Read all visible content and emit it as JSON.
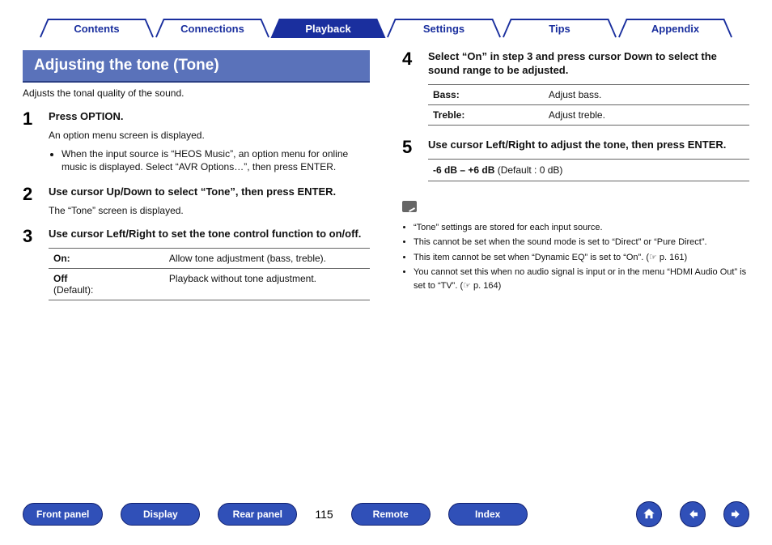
{
  "tabs": {
    "contents": "Contents",
    "connections": "Connections",
    "playback": "Playback",
    "settings": "Settings",
    "tips": "Tips",
    "appendix": "Appendix",
    "active_index": 2
  },
  "heading": "Adjusting the tone (Tone)",
  "subtitle": "Adjusts the tonal quality of the sound.",
  "steps": {
    "s1": {
      "num": "1",
      "title": "Press OPTION.",
      "desc": "An option menu screen is displayed.",
      "bullet": "When the input source is “HEOS Music”, an option menu for online music is displayed. Select “AVR Options…”, then press ENTER."
    },
    "s2": {
      "num": "2",
      "title": "Use cursor Up/Down to select “Tone”, then press ENTER.",
      "desc": "The “Tone” screen is displayed."
    },
    "s3": {
      "num": "3",
      "title": "Use cursor Left/Right to set the tone control function to on/off.",
      "table": {
        "r1_key": "On:",
        "r1_val": "Allow tone adjustment (bass, treble).",
        "r2_key": "Off",
        "r2_sub": "(Default):",
        "r2_val": "Playback without tone adjustment."
      }
    },
    "s4": {
      "num": "4",
      "title": "Select “On” in step 3 and press cursor Down to select the sound range to be adjusted.",
      "table": {
        "r1_key": "Bass:",
        "r1_val": "Adjust bass.",
        "r2_key": "Treble:",
        "r2_val": "Adjust treble."
      }
    },
    "s5": {
      "num": "5",
      "title": "Use cursor Left/Right to adjust the tone, then press ENTER.",
      "range_bold": "-6 dB – +6 dB",
      "range_rest": " (Default : 0 dB)"
    }
  },
  "notes": {
    "n1": "“Tone” settings are stored for each input source.",
    "n2": "This cannot be set when the sound mode is set to “Direct” or “Pure Direct”.",
    "n3": "This item cannot be set when “Dynamic EQ” is set to “On”.  (☞ p. 161)",
    "n4": "You cannot set this when no audio signal is input or in the menu “HDMI Audio Out” is set to “TV”.  (☞ p. 164)"
  },
  "bottom": {
    "front_panel": "Front panel",
    "display": "Display",
    "rear_panel": "Rear panel",
    "page": "115",
    "remote": "Remote",
    "index": "Index"
  }
}
